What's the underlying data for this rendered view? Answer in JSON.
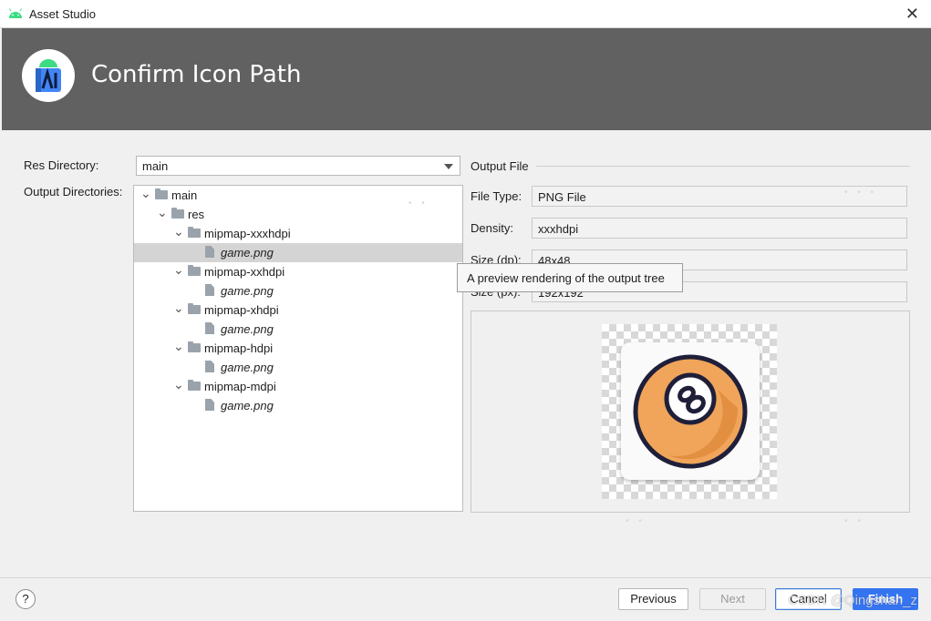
{
  "window": {
    "title": "Asset Studio"
  },
  "header": {
    "title": "Confirm Icon Path"
  },
  "form": {
    "res_directory_label": "Res Directory:",
    "res_directory_value": "main",
    "output_directories_label": "Output Directories:"
  },
  "tree": [
    {
      "label": "main",
      "kind": "folder",
      "level": 0,
      "italic": false,
      "selected": false
    },
    {
      "label": "res",
      "kind": "folder",
      "level": 1,
      "italic": false,
      "selected": false
    },
    {
      "label": "mipmap-xxxhdpi",
      "kind": "folder",
      "level": 2,
      "italic": false,
      "selected": false
    },
    {
      "label": "game.png",
      "kind": "file",
      "level": 3,
      "italic": true,
      "selected": true
    },
    {
      "label": "mipmap-xxhdpi",
      "kind": "folder",
      "level": 2,
      "italic": false,
      "selected": false
    },
    {
      "label": "game.png",
      "kind": "file",
      "level": 3,
      "italic": true,
      "selected": false
    },
    {
      "label": "mipmap-xhdpi",
      "kind": "folder",
      "level": 2,
      "italic": false,
      "selected": false
    },
    {
      "label": "game.png",
      "kind": "file",
      "level": 3,
      "italic": true,
      "selected": false
    },
    {
      "label": "mipmap-hdpi",
      "kind": "folder",
      "level": 2,
      "italic": false,
      "selected": false
    },
    {
      "label": "game.png",
      "kind": "file",
      "level": 3,
      "italic": true,
      "selected": false
    },
    {
      "label": "mipmap-mdpi",
      "kind": "folder",
      "level": 2,
      "italic": false,
      "selected": false
    },
    {
      "label": "game.png",
      "kind": "file",
      "level": 3,
      "italic": true,
      "selected": false
    }
  ],
  "output_file": {
    "section_title": "Output File",
    "file_type_label": "File Type:",
    "file_type_value": "PNG File",
    "density_label": "Density:",
    "density_value": "xxxhdpi",
    "size_dp_label": "Size (dp):",
    "size_dp_value": "48x48",
    "size_px_label": "Size (px):",
    "size_px_value": "192x192"
  },
  "tooltip": {
    "text": "A preview rendering of the output tree"
  },
  "footer": {
    "help_label": "?",
    "previous_label": "Previous",
    "next_label": "Next",
    "cancel_label": "Cancel",
    "finish_label": "Finish"
  },
  "watermark": "CSDN @Qingshan_z",
  "colors": {
    "header_bg": "#616161",
    "primary_button": "#3574f0",
    "ball_orange": "#f0a55a",
    "ball_outline": "#1f1f3a"
  },
  "icons": [
    "android-icon",
    "close-icon",
    "android-studio-logo-icon",
    "chevron-down-icon",
    "folder-icon",
    "file-icon",
    "eight-ball-icon",
    "help-icon"
  ]
}
